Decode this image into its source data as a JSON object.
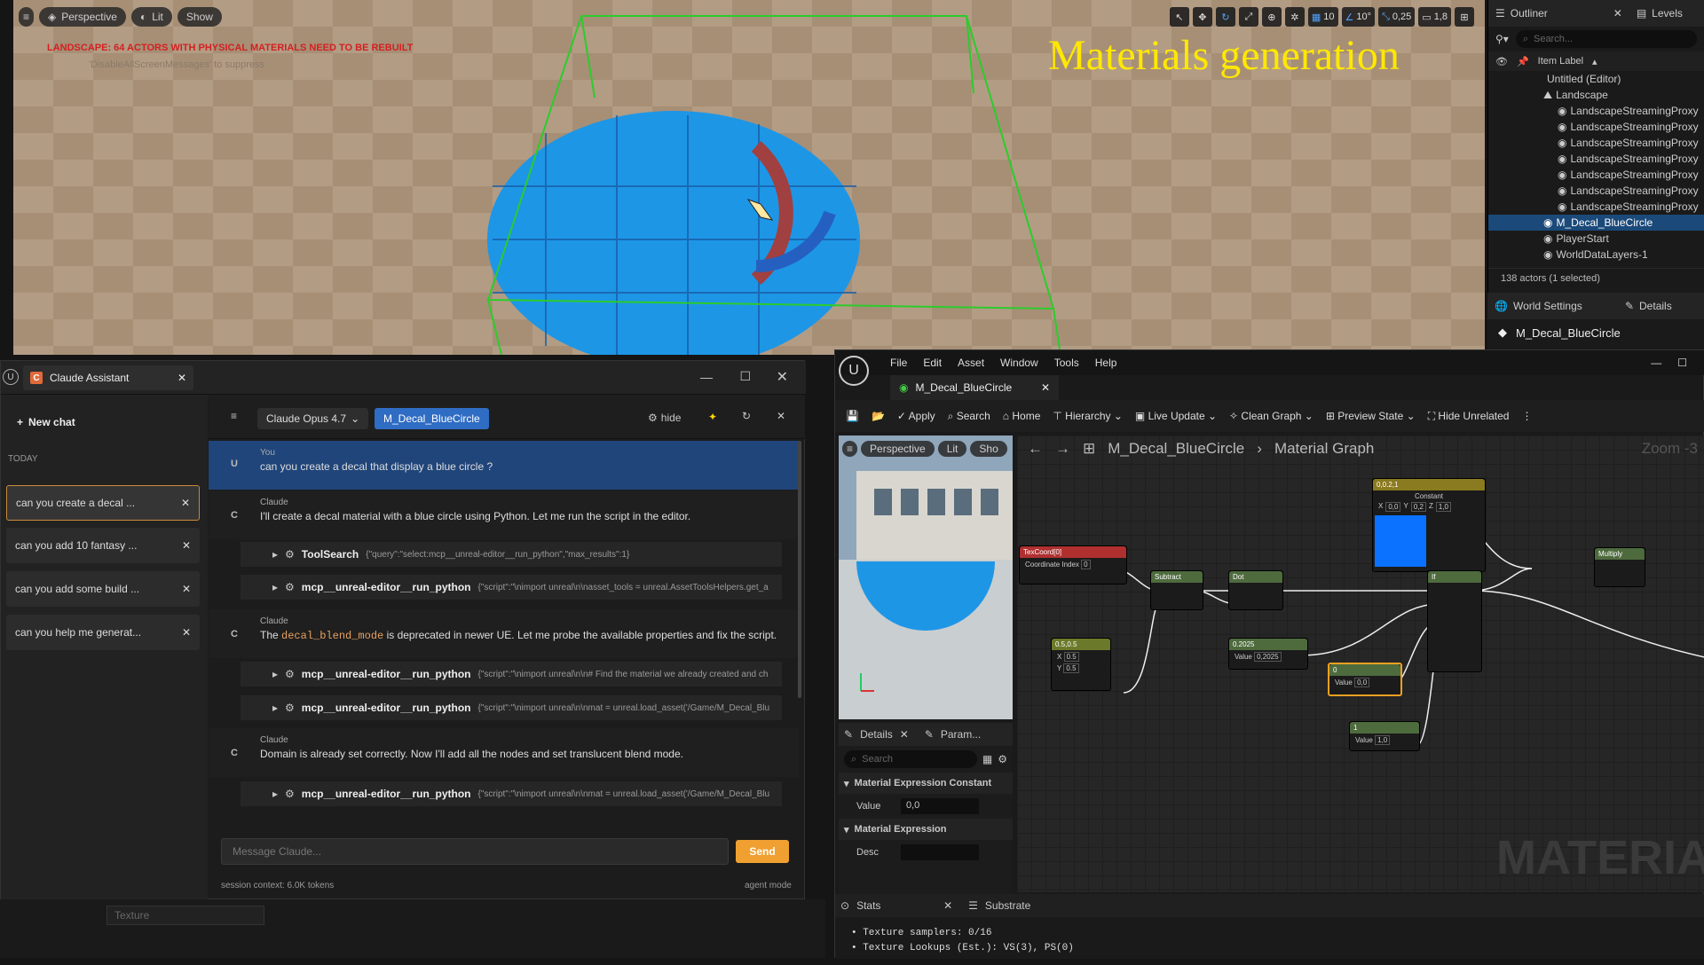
{
  "viewport": {
    "perspective_label": "Perspective",
    "lit_label": "Lit",
    "show_label": "Show",
    "warning": "LANDSCAPE: 64 ACTORS WITH PHYSICAL MATERIALS NEED TO BE REBUILT",
    "warning_sub": "'DisableAllScreenMessages' to suppress",
    "overlay_title": "Materials generation",
    "grid_snap": "10",
    "rot_snap": "10°",
    "scale_snap": "0,25",
    "cam_speed": "1,8"
  },
  "outliner": {
    "tab_label": "Outliner",
    "levels_tab": "Levels",
    "search_placeholder": "Search...",
    "col_label": "Item Label",
    "rows": [
      "Untitled (Editor)",
      "Landscape",
      "LandscapeStreamingProxy",
      "LandscapeStreamingProxy",
      "LandscapeStreamingProxy",
      "LandscapeStreamingProxy",
      "LandscapeStreamingProxy",
      "LandscapeStreamingProxy",
      "LandscapeStreamingProxy",
      "M_Decal_BlueCircle",
      "PlayerStart",
      "WorldDataLayers-1"
    ],
    "status": "138 actors (1 selected)",
    "world_settings": "World Settings",
    "details_tab": "Details",
    "selected_name": "M_Decal_BlueCircle"
  },
  "claude": {
    "window_title": "Claude Assistant",
    "new_chat": "New chat",
    "today": "TODAY",
    "history": [
      "can you create a decal ...",
      "can you add 10 fantasy ...",
      "can you add some build ...",
      "can you help me generat..."
    ],
    "model": "Claude Opus 4.7",
    "asset_chip": "M_Decal_BlueCircle",
    "hide": "hide",
    "user_name": "You",
    "user_msg": "can you create a decal that display a blue circle ?",
    "assistant_name": "Claude",
    "msg1": "I'll create a decal material with a blue circle using Python. Let me run the script in the editor.",
    "tool1_name": "ToolSearch",
    "tool1_args": "{\"query\":\"select:mcp__unreal-editor__run_python\",\"max_results\":1}",
    "tool2_name": "mcp__unreal-editor__run_python",
    "tool2_args": "{\"script\":\"\\nimport unreal\\n\\nasset_tools = unreal.AssetToolsHelpers.get_a",
    "msg2_pre": "The ",
    "msg2_code": "decal_blend_mode",
    "msg2_post": " is deprecated in newer UE. Let me probe the available properties and fix the script.",
    "tool3_name": "mcp__unreal-editor__run_python",
    "tool3_args": "{\"script\":\"\\nimport unreal\\n\\n# Find the material we already created and ch",
    "tool4_name": "mcp__unreal-editor__run_python",
    "tool4_args": "{\"script\":\"\\nimport unreal\\n\\nmat = unreal.load_asset('/Game/M_Decal_Blu",
    "msg3": "Domain is already set correctly. Now I'll add all the nodes and set translucent blend mode.",
    "tool5_name": "mcp__unreal-editor__run_python",
    "tool5_args": "{\"script\":\"\\nimport unreal\\n\\nmat = unreal.load_asset('/Game/M_Decal_Blu",
    "input_placeholder": "Message Claude...",
    "send": "Send",
    "session": "session context: 6.0K tokens",
    "mode": "agent mode",
    "texture_placeholder": "Texture"
  },
  "material_editor": {
    "menu": [
      "File",
      "Edit",
      "Asset",
      "Window",
      "Tools",
      "Help"
    ],
    "asset_tab": "M_Decal_BlueCircle",
    "toolbar": [
      "Apply",
      "Search",
      "Home",
      "Hierarchy",
      "Live Update",
      "Clean Graph",
      "Preview State",
      "Hide Unrelated"
    ],
    "preview_perspective": "Perspective",
    "preview_lit": "Lit",
    "preview_show": "Sho",
    "breadcrumb_asset": "M_Decal_BlueCircle",
    "breadcrumb_graph": "Material Graph",
    "zoom": "Zoom -3",
    "details_tab": "Details",
    "params_tab": "Param...",
    "details_search": "Search",
    "section1": "Material Expression Constant",
    "value_label": "Value",
    "value": "0,0",
    "section2": "Material Expression",
    "desc_label": "Desc",
    "watermark": "MATERIAL",
    "stats_tab": "Stats",
    "substrate_tab": "Substrate",
    "stats_lines": [
      "Texture samplers: 0/16",
      "Texture Lookups (Est.): VS(3), PS(0)"
    ],
    "nodes": {
      "texcoord": "TexCoord[0]",
      "coord_index": "Coordinate Index",
      "coord_val": "0",
      "subtract": "Subtract",
      "dot": "Dot",
      "const2": "0.5,0.5",
      "x_val": "0.5",
      "y_val": "0.5",
      "c2025": "0.2025",
      "c2025_val": "0,2025",
      "c0": "0",
      "c0_val": "0,0",
      "c1": "1",
      "c1_val": "1,0",
      "vec3": "0,0.2,1",
      "vec3_sub": "Constant",
      "vec3_x": "0,0",
      "vec3_y": "0,2",
      "vec3_z": "1,0",
      "if": "If",
      "multiply": "Multiply"
    }
  }
}
